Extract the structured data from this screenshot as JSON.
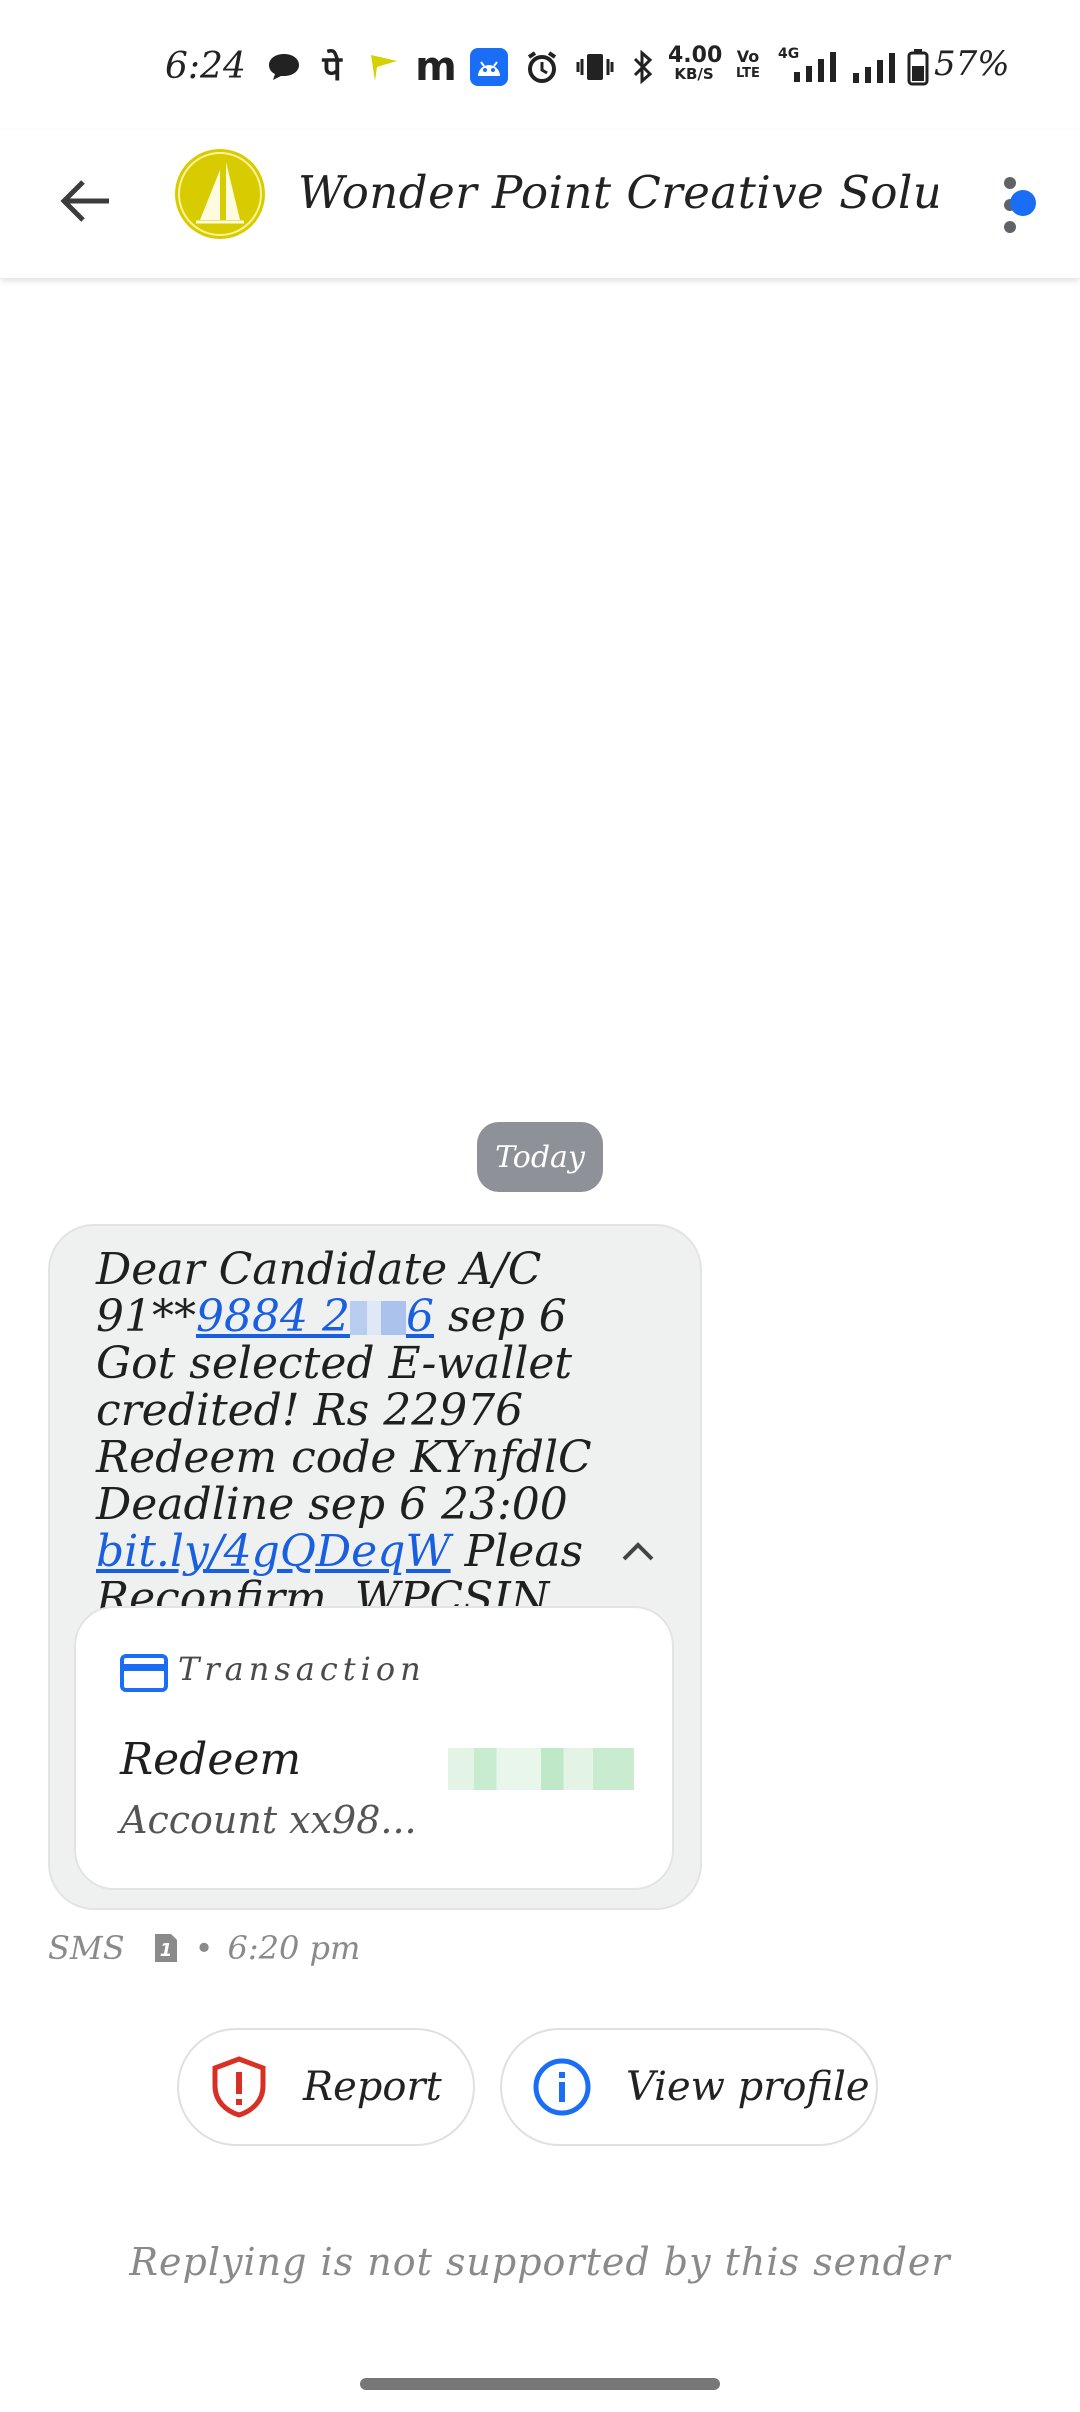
{
  "status_bar": {
    "time": "6:24",
    "icons": [
      "chat-bubble-icon",
      "phonepe-icon",
      "flag-icon",
      "m-app-icon",
      "android-icon",
      "alarm-icon",
      "vibrate-icon",
      "bluetooth-icon",
      "net-speed",
      "volte-icon",
      "4g-signal-icon",
      "signal-icon",
      "battery-icon"
    ],
    "net_speed_value": "4.00",
    "net_speed_unit": "KB/S",
    "volte_top": "Vo",
    "volte_bottom": "LTE",
    "network_type": "4G",
    "battery_percent": "57%"
  },
  "app_bar": {
    "sender_name": "Wonder Point Creative Solutio...",
    "avatar_color": "#d8cc00",
    "notification_dot_color": "#1a6ef5"
  },
  "conversation": {
    "date_chip": "Today",
    "message": {
      "part1": "Dear Candidate A/C 91**",
      "phone_link_start": "9884 2",
      "phone_link_end": "6",
      "part2": " sep 6 Got selected E-wallet credited! Rs 22976 Redeem code KYnfdlC Deadline sep 6 23:00 ",
      "url_link": "bit.ly/4gQDeqW",
      "part3": " Pleas Reconfirm .WPCSIN"
    },
    "transaction_card": {
      "label": "Transaction",
      "title": "Redeem",
      "subtitle": "Account xx98..."
    },
    "meta": {
      "type": "SMS",
      "sim": "1",
      "separator": "•",
      "time": "6:20 pm"
    }
  },
  "actions": {
    "report_label": "Report",
    "view_profile_label": "View profile"
  },
  "footer": {
    "reply_note": "Replying is not supported by this sender"
  }
}
